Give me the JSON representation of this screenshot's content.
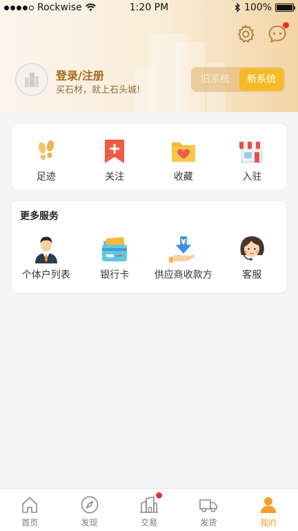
{
  "status_bar": {
    "carrier": "Rockwise",
    "time": "1:20 PM",
    "battery": "100%"
  },
  "header": {
    "login_title": "登录/注册",
    "login_subtitle": "买石材，就上石头城!",
    "old_system_label": "旧系统",
    "new_system_label": "新系统",
    "icons": [
      "settings-icon",
      "message-icon"
    ]
  },
  "quick_actions": [
    {
      "label": "足迹",
      "icon": "footprints-icon"
    },
    {
      "label": "关注",
      "icon": "bookmark-plus-icon"
    },
    {
      "label": "收藏",
      "icon": "heart-folder-icon"
    },
    {
      "label": "入驻",
      "icon": "shop-icon"
    }
  ],
  "more_services": {
    "title": "更多服务",
    "items": [
      {
        "label": "个体户列表",
        "icon": "businessman-icon"
      },
      {
        "label": "银行卡",
        "icon": "bank-card-icon"
      },
      {
        "label": "供应商收款方",
        "icon": "yuan-payment-icon"
      },
      {
        "label": "客服",
        "icon": "customer-service-icon"
      }
    ]
  },
  "tab_bar": {
    "active": "我的",
    "tabs": [
      {
        "label": "首页",
        "icon": "home-icon"
      },
      {
        "label": "发现",
        "icon": "compass-icon"
      },
      {
        "label": "交易",
        "icon": "buildings-icon"
      },
      {
        "label": "发货",
        "icon": "truck-icon"
      },
      {
        "label": "我的",
        "icon": "user-icon"
      }
    ]
  },
  "colors": {
    "accent": "#f3a026",
    "new_system_bg": "#f7b924",
    "badge": "#e7312f",
    "header_gradient_end": "#f3d4a4"
  }
}
